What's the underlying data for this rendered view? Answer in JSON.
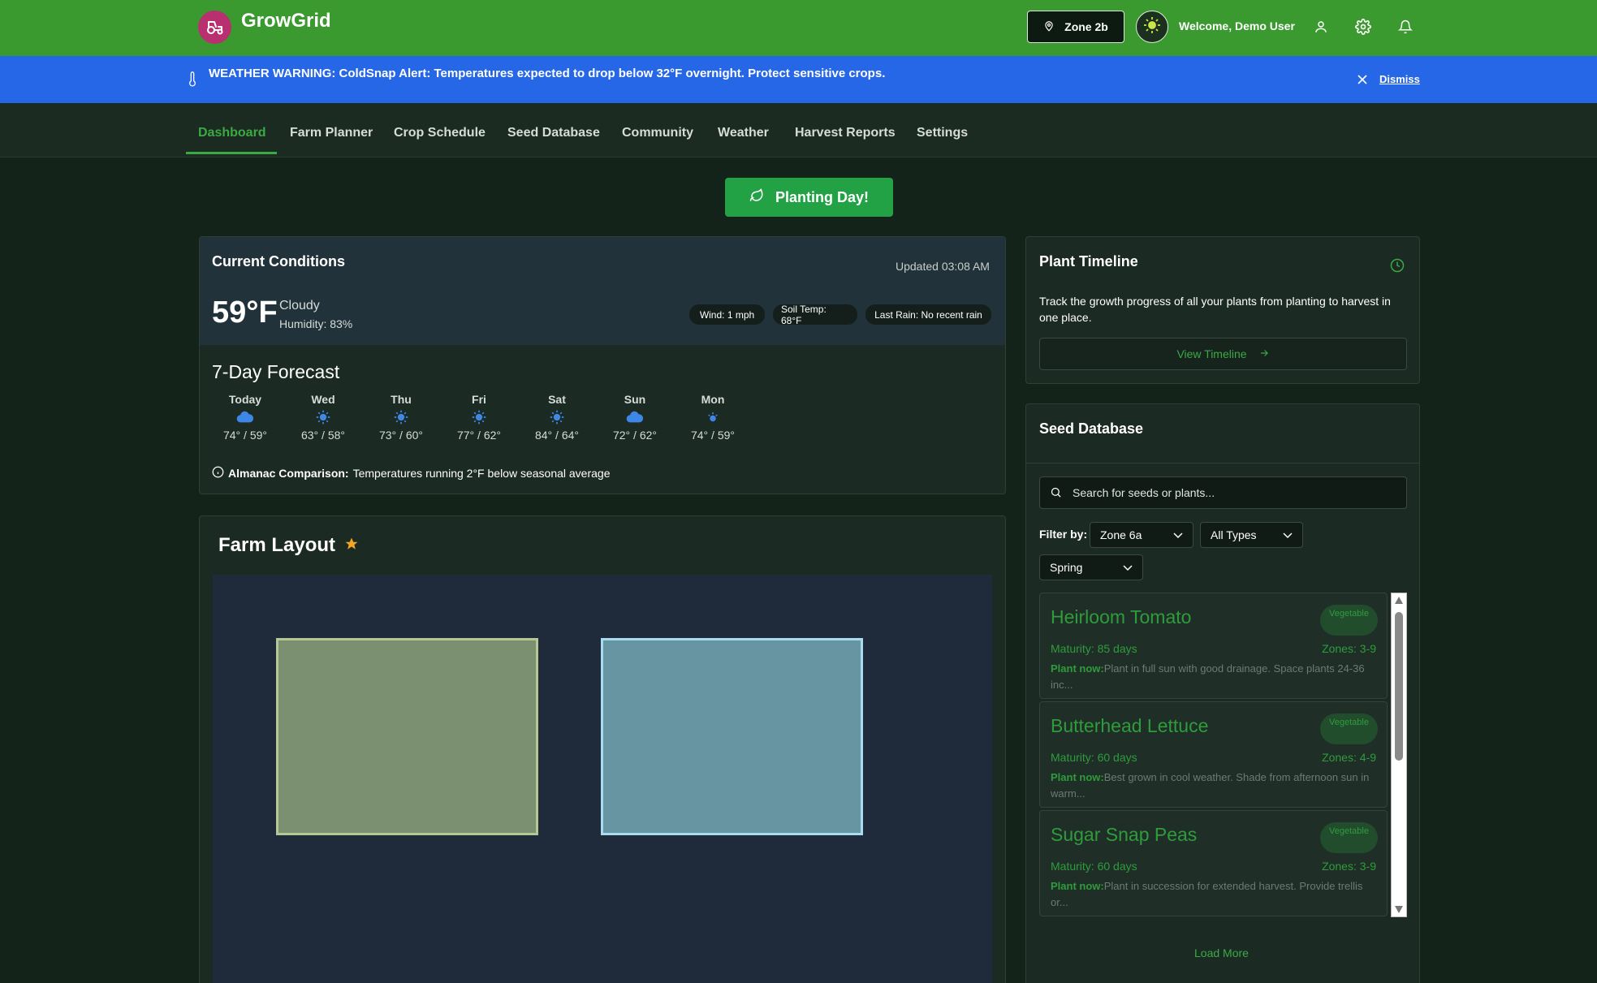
{
  "header": {
    "brand": "GrowGrid",
    "zone_label": "Zone 2b",
    "welcome": "Welcome, Demo User"
  },
  "alert": {
    "label": "WEATHER WARNING:",
    "message": "ColdSnap Alert: Temperatures expected to drop below 32°F overnight. Protect sensitive crops.",
    "dismiss": "Dismiss"
  },
  "nav": {
    "items": [
      "Dashboard",
      "Farm Planner",
      "Crop Schedule",
      "Seed Database",
      "Community",
      "Weather",
      "Harvest Reports",
      "Settings"
    ],
    "active": "Dashboard"
  },
  "planting_button": "Planting Day!",
  "conditions": {
    "title": "Current Conditions",
    "updated": "Updated 03:08 AM",
    "temperature": "59°F",
    "condition": "Cloudy",
    "humidity": "Humidity: 83%",
    "wind": "Wind: 1 mph",
    "soil_temp": "Soil Temp: 68°F",
    "last_rain": "Last Rain: No recent rain"
  },
  "forecast": {
    "title": "7-Day Forecast",
    "days": [
      {
        "name": "Today",
        "icon": "cloud-icon",
        "temps": "74° / 59°"
      },
      {
        "name": "Wed",
        "icon": "sun-icon",
        "temps": "63° / 58°"
      },
      {
        "name": "Thu",
        "icon": "sun-icon",
        "temps": "73° / 60°"
      },
      {
        "name": "Fri",
        "icon": "sun-icon",
        "temps": "77° / 62°"
      },
      {
        "name": "Sat",
        "icon": "sun-icon",
        "temps": "84° / 64°"
      },
      {
        "name": "Sun",
        "icon": "cloud-icon",
        "temps": "72° / 62°"
      },
      {
        "name": "Mon",
        "icon": "partly-sunny-icon",
        "temps": "74° / 59°"
      }
    ],
    "almanac_label": "Almanac Comparison:",
    "almanac_text": "Temperatures running 2°F below seasonal average"
  },
  "farm_layout": {
    "title": "Farm Layout"
  },
  "timeline": {
    "title": "Plant Timeline",
    "description": "Track the growth progress of all your plants from planting to harvest in one place.",
    "button": "View Timeline"
  },
  "seed_db": {
    "title": "Seed Database",
    "search_placeholder": "Search for seeds or plants...",
    "filter_label": "Filter by:",
    "filters": {
      "zone": "Zone 6a",
      "type": "All Types",
      "season": "Spring"
    },
    "seeds": [
      {
        "name": "Heirloom Tomato",
        "tag": "Vegetable",
        "maturity": "Maturity: 85 days",
        "zones": "Zones: 3-9",
        "plant_label": "Plant now:",
        "plant_text": "Plant in full sun with good drainage. Space plants 24-36 inc..."
      },
      {
        "name": "Butterhead Lettuce",
        "tag": "Vegetable",
        "maturity": "Maturity: 60 days",
        "zones": "Zones: 4-9",
        "plant_label": "Plant now:",
        "plant_text": "Best grown in cool weather. Shade from afternoon sun in warm..."
      },
      {
        "name": "Sugar Snap Peas",
        "tag": "Vegetable",
        "maturity": "Maturity: 60 days",
        "zones": "Zones: 3-9",
        "plant_label": "Plant now:",
        "plant_text": "Plant in succession for extended harvest. Provide trellis or..."
      }
    ],
    "load_more": "Load More"
  },
  "colors": {
    "header": "#3b9a2f",
    "alert": "#2667e8",
    "accent": "#3aaa44",
    "background": "#14231a"
  }
}
